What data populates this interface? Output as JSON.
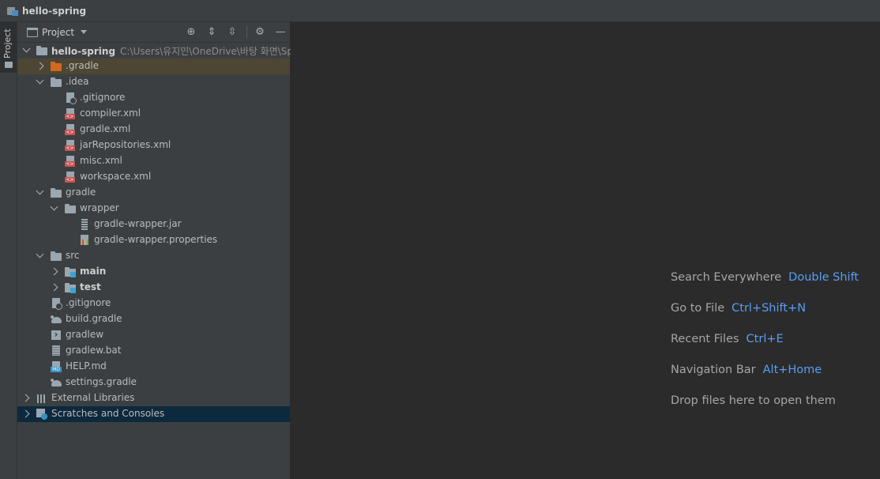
{
  "window": {
    "title": "hello-spring"
  },
  "tool_strip": {
    "project_tab_label": "Project"
  },
  "panel": {
    "view_label": "Project",
    "icons": [
      "locate-icon",
      "expand-all-icon",
      "collapse-all-icon",
      "gear-icon",
      "minimize-icon"
    ]
  },
  "tree": {
    "root": {
      "label": "hello-spring",
      "path": "C:\\Users\\유지민\\OneDrive\\바탕 화면\\Spring"
    },
    "gradle_dir": ".gradle",
    "idea_dir": ".idea",
    "idea_files": [
      ".gitignore",
      "compiler.xml",
      "gradle.xml",
      "jarRepositories.xml",
      "misc.xml",
      "workspace.xml"
    ],
    "gradle_folder": "gradle",
    "wrapper_folder": "wrapper",
    "wrapper_files": [
      "gradle-wrapper.jar",
      "gradle-wrapper.properties"
    ],
    "src_folder": "src",
    "src_children": [
      "main",
      "test"
    ],
    "root_files": [
      ".gitignore",
      "build.gradle",
      "gradlew",
      "gradlew.bat",
      "HELP.md",
      "settings.gradle"
    ],
    "external_libraries": "External Libraries",
    "scratches": "Scratches and Consoles"
  },
  "editor": {
    "hints": [
      {
        "text": "Search Everywhere",
        "key": "Double Shift"
      },
      {
        "text": "Go to File",
        "key": "Ctrl+Shift+N"
      },
      {
        "text": "Recent Files",
        "key": "Ctrl+E"
      },
      {
        "text": "Navigation Bar",
        "key": "Alt+Home"
      },
      {
        "text": "Drop files here to open them",
        "key": ""
      }
    ]
  },
  "colors": {
    "panel_bg": "#3c3f41",
    "editor_bg": "#2b2b2b",
    "shortcut_blue": "#589df6",
    "selection_bg": "#0d293e",
    "excluded_folder_bg": "#4d4634"
  }
}
